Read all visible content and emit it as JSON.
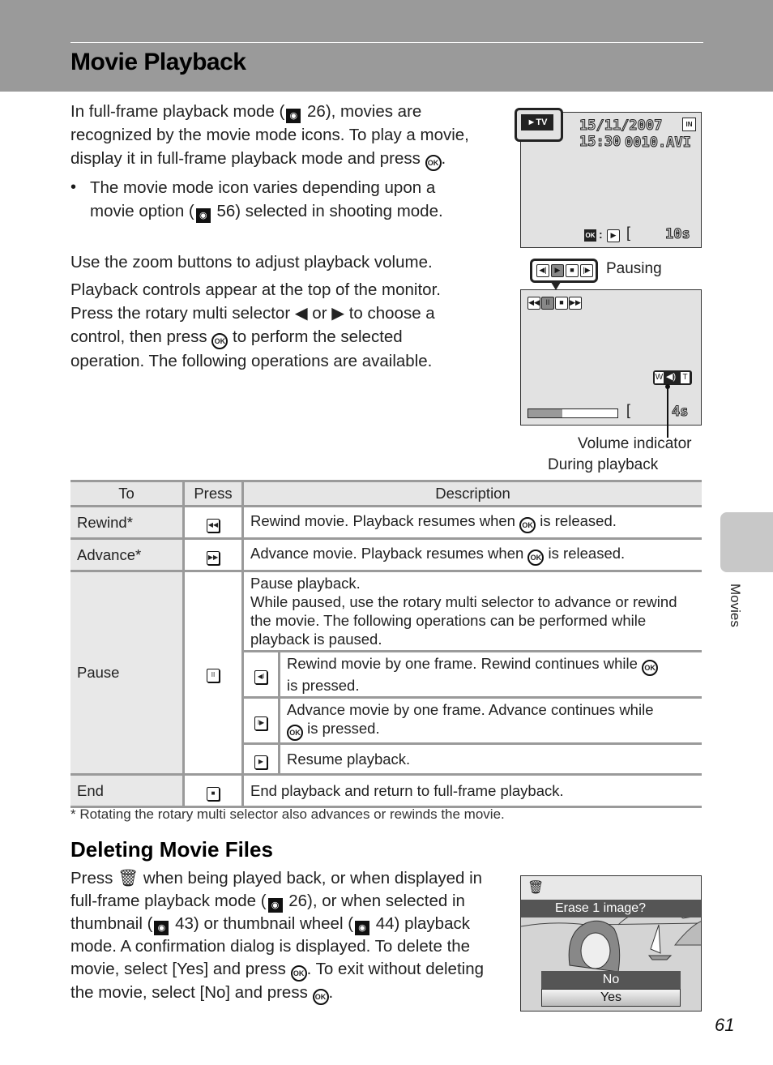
{
  "header": {
    "title": "Movie Playback"
  },
  "intro": {
    "lines": [
      "In full-frame playback mode (",
      " 26), movies are",
      "recognized by the movie mode icons. To play a movie,",
      "display it in full-frame playback mode and press ",
      "."
    ],
    "bullet": [
      "The movie mode icon varies depending upon a",
      "movie option (",
      " 56) selected in shooting mode."
    ]
  },
  "volume_text": "Use the zoom buttons to adjust playback volume.",
  "controls_text": {
    "line1": "Playback controls appear at the top of the monitor.",
    "line2a": "Press the rotary multi selector ",
    "line2b": " or ",
    "line2c": " to choose a",
    "line3a": "control, then press ",
    "line3b": " to perform the selected",
    "line4": "operation. The following operations are available."
  },
  "screen1": {
    "mode_icon": "movie-tv-icon",
    "date": "15/11/2007 15:30",
    "memory_icon": "IN",
    "filename": "0010.AVI",
    "ok_hint": "OK",
    "duration": "10s"
  },
  "screen2": {
    "pausing_label": "Pausing",
    "during_label": "During playback",
    "volume_label": "Volume indicator",
    "time_remaining": "4s",
    "progress": 0.38,
    "volume_w": "W",
    "volume_t": "T"
  },
  "table": {
    "headers": [
      "To",
      "Press",
      "Description"
    ],
    "rows": {
      "rewind": {
        "to": "Rewind*",
        "desc_a": "Rewind movie. Playback resumes when ",
        "desc_b": " is released."
      },
      "advance": {
        "to": "Advance*",
        "desc_a": "Advance movie. Playback resumes when ",
        "desc_b": " is released."
      },
      "pause": {
        "to": "Pause",
        "desc": [
          "Pause playback.",
          "While paused, use the rotary multi selector to advance or rewind",
          "the movie. The following operations can be performed while",
          "playback is paused."
        ],
        "sub": {
          "frame_rewind_a": "Rewind movie by one frame. Rewind continues while ",
          "frame_rewind_b": "is pressed.",
          "frame_advance_a": "Advance movie by one frame. Advance continues while",
          "frame_advance_b": " is pressed.",
          "resume": "Resume playback."
        }
      },
      "end": {
        "to": "End",
        "desc": "End playback and return to full-frame playback."
      }
    }
  },
  "footnote": "*  Rotating the rotary multi selector also advances or rewinds the movie.",
  "deleting": {
    "title": "Deleting Movie Files",
    "l1a": "Press ",
    "l1b": " when being played back, or when displayed in",
    "l2a": "full-frame playback mode (",
    "l2b": " 26), or when selected in",
    "l3a": "thumbnail (",
    "l3b": " 43) or thumbnail wheel (",
    "l3c": " 44) playback",
    "l4": "mode. A confirmation dialog is displayed. To delete the",
    "l5a": "movie, select [Yes] and press ",
    "l5b": ". To exit without deleting",
    "l6a": "the movie, select [No] and press ",
    "l6b": "."
  },
  "dialog": {
    "prompt": "Erase 1 image?",
    "no": "No",
    "yes": "Yes",
    "selected": "Yes"
  },
  "side_tab": "Movies",
  "page_number": "61",
  "icons": {
    "ok": "OK",
    "ref": "☻"
  }
}
